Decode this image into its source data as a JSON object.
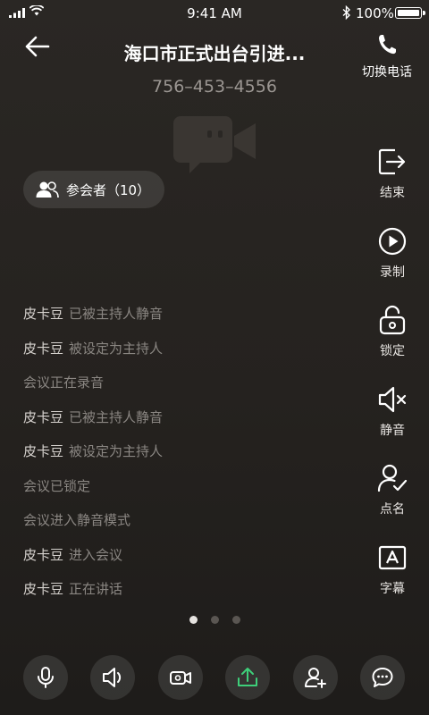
{
  "status_bar": {
    "time": "9:41 AM",
    "battery_percent": "100%"
  },
  "header": {
    "title": "海口市正式出台引进...",
    "phone_number": "756–453–4556",
    "switch_phone_label": "切换电话"
  },
  "participants_button": {
    "label": "参会者（10）"
  },
  "activity_log": [
    {
      "name": "皮卡豆",
      "message": "已被主持人静音"
    },
    {
      "name": "皮卡豆",
      "message": "被设定为主持人"
    },
    {
      "name": "",
      "message": "会议正在录音"
    },
    {
      "name": "皮卡豆",
      "message": "已被主持人静音"
    },
    {
      "name": "皮卡豆",
      "message": "被设定为主持人"
    },
    {
      "name": "",
      "message": "会议已锁定"
    },
    {
      "name": "",
      "message": "会议进入静音模式"
    },
    {
      "name": "皮卡豆",
      "message": "进入会议"
    },
    {
      "name": "皮卡豆",
      "message": "正在讲话"
    }
  ],
  "side_actions": [
    {
      "icon": "exit-icon",
      "label": "结束"
    },
    {
      "icon": "record-play-icon",
      "label": "录制"
    },
    {
      "icon": "unlock-icon",
      "label": "锁定"
    },
    {
      "icon": "speaker-mute-icon",
      "label": "静音"
    },
    {
      "icon": "user-check-icon",
      "label": "点名"
    },
    {
      "icon": "caption-icon",
      "label": "字幕"
    }
  ],
  "pager": {
    "count": 3,
    "active": 0
  },
  "bottom_toolbar": [
    {
      "icon": "microphone-icon"
    },
    {
      "icon": "speaker-icon"
    },
    {
      "icon": "video-camera-icon"
    },
    {
      "icon": "share-upload-icon",
      "color": "#3ecf7a"
    },
    {
      "icon": "add-user-icon"
    },
    {
      "icon": "chat-icon"
    }
  ],
  "colors": {
    "accent_green": "#3ecf7a",
    "background": "#27241f",
    "muted_text": "#8a8682"
  }
}
